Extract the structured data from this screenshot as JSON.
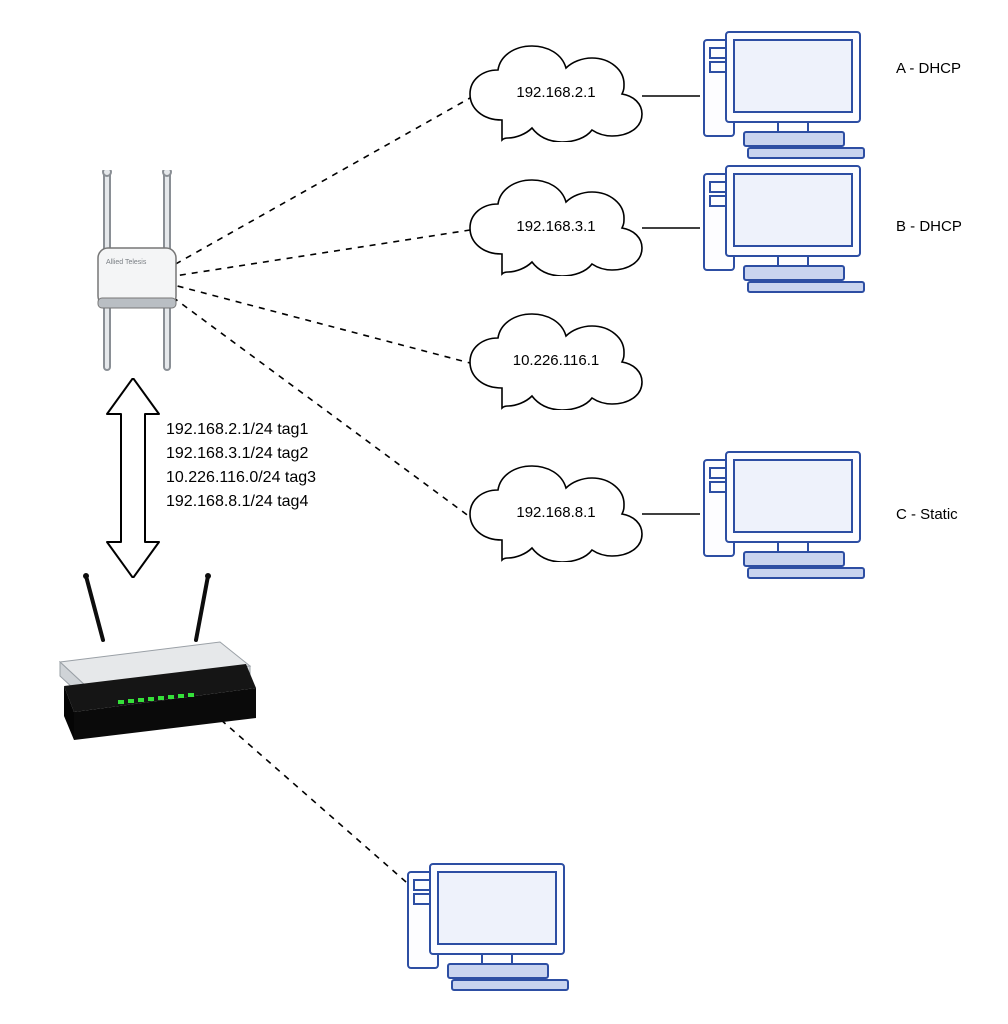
{
  "clouds": {
    "c1": "192.168.2.1",
    "c2": "192.168.3.1",
    "c3": "10.226.116.1",
    "c4": "192.168.8.1"
  },
  "hosts": {
    "a": "A - DHCP",
    "b": "B - DHCP",
    "c": "C - Static"
  },
  "vlans": {
    "l1": "192.168.2.1/24 tag1",
    "l2": "192.168.3.1/24 tag2",
    "l3": "10.226.116.0/24 tag3",
    "l4": "192.168.8.1/24 tag4"
  }
}
